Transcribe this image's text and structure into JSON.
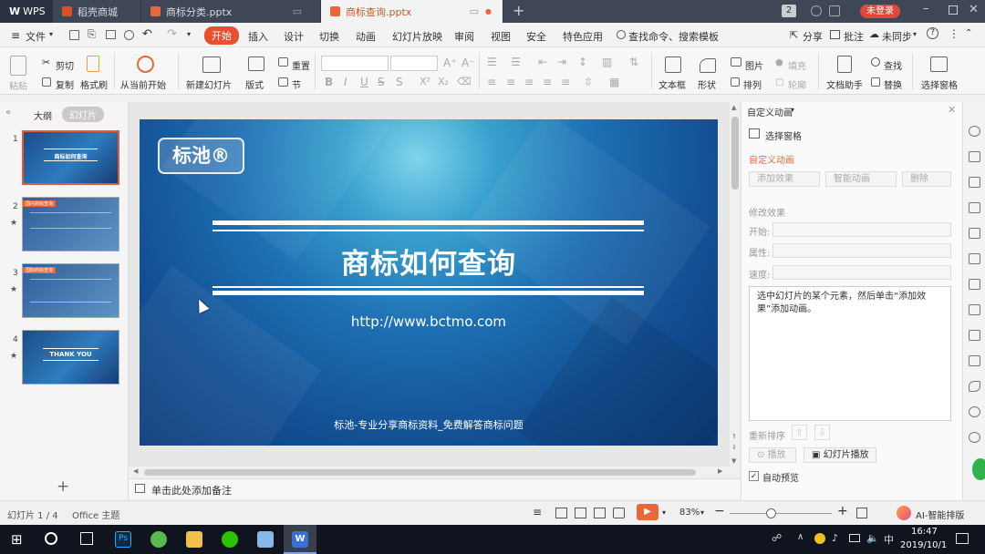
{
  "titlebar": {
    "app_name": "WPS",
    "tabs": [
      {
        "label": "稻壳商城",
        "icon_color": "#e14d2a"
      },
      {
        "label": "商标分类.pptx",
        "icon_color": "#e9683b"
      },
      {
        "label": "商标查询.pptx",
        "icon_color": "#e9683b"
      }
    ],
    "badge": "2",
    "login_label": "未登录",
    "colors": {
      "bg": "#3f4656",
      "login": "#e0483c"
    }
  },
  "menubar": {
    "file_label": "文件",
    "items": [
      "开始",
      "插入",
      "设计",
      "切换",
      "动画",
      "幻灯片放映",
      "审阅",
      "视图",
      "安全",
      "特色应用"
    ],
    "search_placeholder": "查找命令、搜索模板",
    "share": "分享",
    "comment": "批注",
    "sync": "未同步",
    "accent": "#e94f2e"
  },
  "ribbon": {
    "paste": "粘贴",
    "cut": "剪切",
    "copy": "复制",
    "format_painter": "格式刷",
    "from_current": "从当前开始",
    "new_slide": "新建幻灯片",
    "layout": "版式",
    "reset": "重置",
    "section": "节",
    "textbox": "文本框",
    "shape": "形状",
    "picture": "图片",
    "arrange": "排列",
    "fill": "填充",
    "outline": "轮廓",
    "find": "查找",
    "replace": "替换",
    "doc_assistant": "文档助手",
    "select_pane": "选择窗格"
  },
  "left_pane": {
    "tab_outline": "大纲",
    "tab_slides": "幻灯片",
    "slides": [
      {
        "num": "1",
        "title": "商标如何查询",
        "selected": true
      },
      {
        "num": "2",
        "title": "国内商标查询",
        "selected": false
      },
      {
        "num": "3",
        "title": "国际商标查询",
        "selected": false
      },
      {
        "num": "4",
        "title": "THANK YOU",
        "selected": false
      }
    ]
  },
  "slide": {
    "logo": "标池®",
    "title": "商标如何查询",
    "url": "http://www.bctmo.com",
    "footer": "标池-专业分享商标资料_免费解答商标问题"
  },
  "notes_placeholder": "单击此处添加备注",
  "right_panel": {
    "header": "自定义动画",
    "select_pane": "选择窗格",
    "section_title": "自定义动画",
    "add_effect": "添加效果",
    "smart_anim": "智能动画",
    "delete": "删除",
    "modify_effect": "修改效果",
    "start_label": "开始:",
    "property_label": "属性:",
    "speed_label": "速度:",
    "hint": "选中幻灯片的某个元素，然后单击“添加效果”添加动画。",
    "reorder": "重新排序",
    "play": "播放",
    "slideshow": "幻灯片播放",
    "autopreview": "自动预览",
    "autopreview_checked": true
  },
  "statusbar": {
    "slide_info": "幻灯片 1 / 4",
    "theme": "Office 主题",
    "zoom": "83%",
    "ai_label": "AI-智能排版"
  },
  "taskbar": {
    "time": "16:47",
    "date": "2019/10/1",
    "ime": "中"
  }
}
